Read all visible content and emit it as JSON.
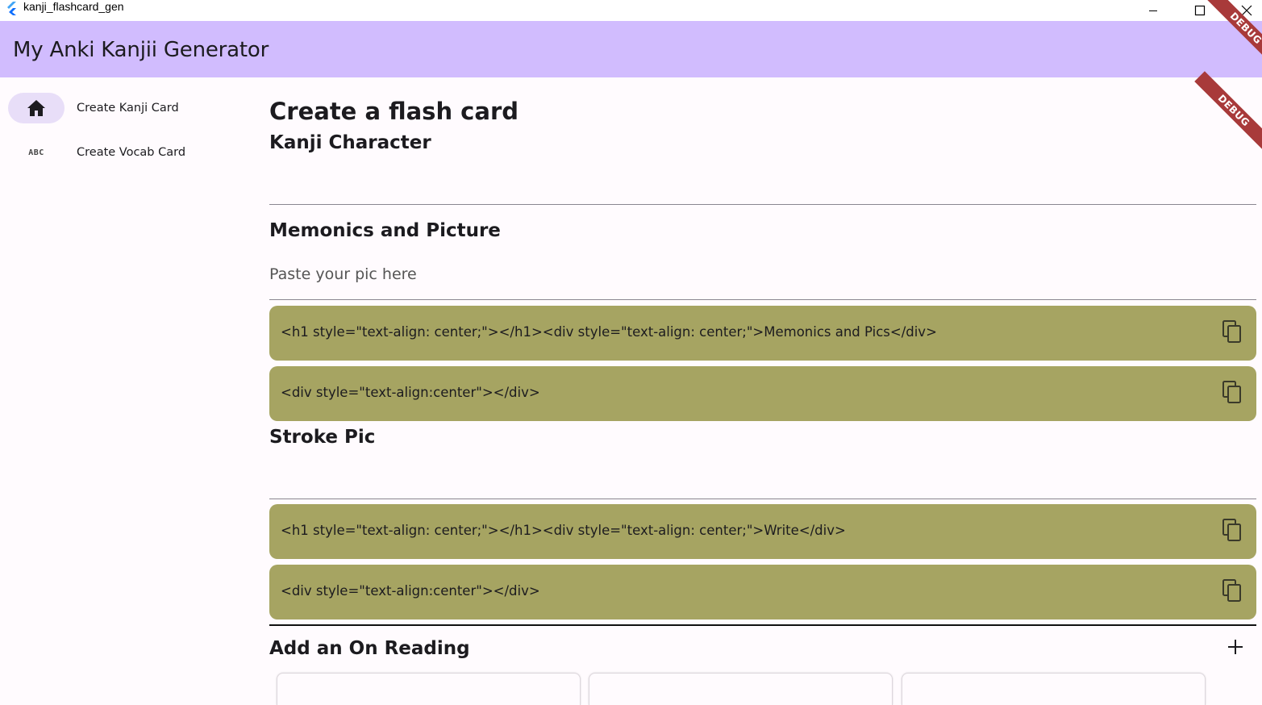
{
  "window": {
    "title": "kanji_flashcard_gen"
  },
  "appbar": {
    "title": "My Anki Kanjii Generator",
    "debug_label": "DEBUG",
    "color": "#d1bcfe"
  },
  "sidebar": {
    "items": [
      {
        "label": "Create Kanji Card",
        "icon": "home-icon",
        "active": true
      },
      {
        "label": "Create Vocab Card",
        "icon": "abc-icon",
        "icon_text": "ABC",
        "active": false
      }
    ]
  },
  "main": {
    "page_title": "Create a flash card",
    "kanji_section": {
      "heading": "Kanji Character"
    },
    "mnemonics_section": {
      "heading": "Memonics and Picture",
      "placeholder": "Paste your pic here",
      "code_blocks": [
        "<h1 style=\"text-align: center;\"></h1><div style=\"text-align: center;\">Memonics and Pics</div>",
        "<div style=\"text-align:center\"></div>"
      ]
    },
    "stroke_section": {
      "heading": "Stroke Pic",
      "code_blocks": [
        "<h1 style=\"text-align: center;\"></h1><div style=\"text-align: center;\">Write</div>",
        "<div style=\"text-align:center\"></div>"
      ]
    },
    "on_reading_section": {
      "heading": "Add an On Reading"
    },
    "debug_label": "DEBUG",
    "code_block_color": "#a6a462"
  }
}
